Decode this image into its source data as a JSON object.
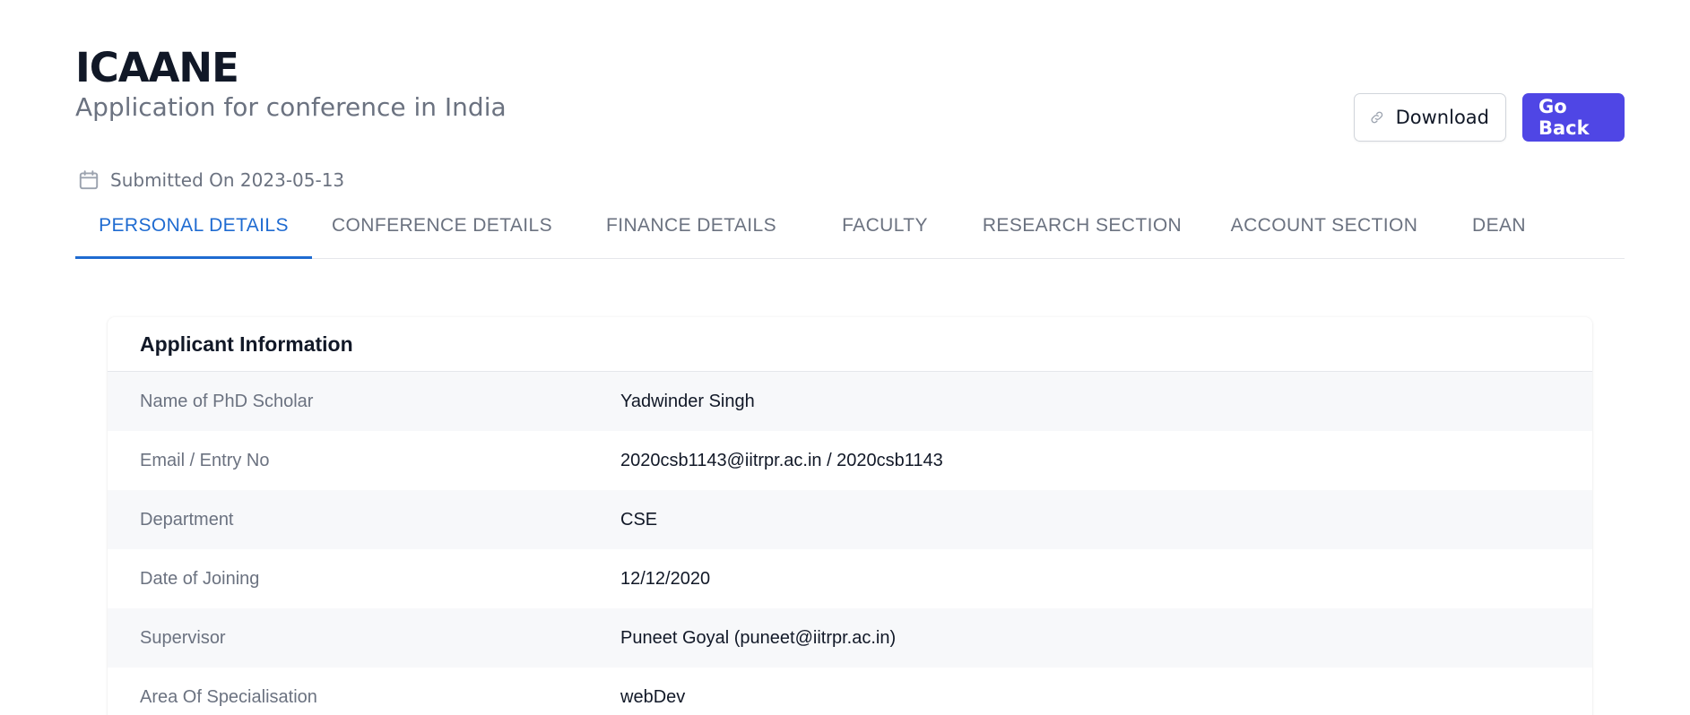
{
  "header": {
    "title": "ICAANE",
    "subtitle": "Application for conference in India"
  },
  "actions": {
    "download_label": "Download",
    "back_label": "Go Back",
    "accent_color": "#4f46e5"
  },
  "submitted": {
    "text": "Submitted On 2023-05-13",
    "icon": "calendar-icon"
  },
  "tabs": [
    {
      "label": "PERSONAL DETAILS",
      "active": true
    },
    {
      "label": "CONFERENCE DETAILS",
      "active": false
    },
    {
      "label": "FINANCE DETAILS",
      "active": false
    },
    {
      "label": "FACULTY",
      "active": false
    },
    {
      "label": "RESEARCH SECTION",
      "active": false
    },
    {
      "label": "ACCOUNT SECTION",
      "active": false
    },
    {
      "label": "DEAN",
      "active": false
    }
  ],
  "applicant": {
    "section_title": "Applicant Information",
    "rows": [
      {
        "label": "Name of PhD Scholar",
        "value": "Yadwinder Singh"
      },
      {
        "label": "Email / Entry No",
        "value": "2020csb1143@iitrpr.ac.in / 2020csb1143"
      },
      {
        "label": "Department",
        "value": "CSE"
      },
      {
        "label": "Date of Joining",
        "value": "12/12/2020"
      },
      {
        "label": "Supervisor",
        "value": "Puneet Goyal (puneet@iitrpr.ac.in)"
      },
      {
        "label": "Area Of Specialisation",
        "value": "webDev"
      }
    ]
  }
}
